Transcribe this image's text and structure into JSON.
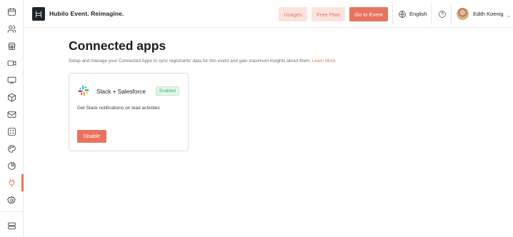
{
  "header": {
    "brand": "Hubilo Event. Reimagine.",
    "usages_label": "Usages",
    "free_plan_label": "Free Plan",
    "go_to_event_label": "Go to Event",
    "language": "English",
    "user_name": "Edith Koenig"
  },
  "sidebar": {
    "items": [
      {
        "icon": "calendar-icon"
      },
      {
        "icon": "users-icon"
      },
      {
        "icon": "store-icon"
      },
      {
        "icon": "video-icon"
      },
      {
        "icon": "screen-share-icon"
      },
      {
        "icon": "box-icon"
      },
      {
        "icon": "mail-icon"
      },
      {
        "icon": "dice-icon"
      },
      {
        "icon": "palette-icon"
      },
      {
        "icon": "pie-chart-icon"
      },
      {
        "icon": "plug-icon",
        "active": true
      },
      {
        "icon": "settings-icon"
      },
      {
        "icon": "server-icon"
      }
    ]
  },
  "main": {
    "title": "Connected apps",
    "subtitle": "Setup and manage your Connected Apps to sync registrants' data for this event and gain maximum insights about them.",
    "learn_more": "Learn More",
    "apps": [
      {
        "icon": "slack-icon",
        "name": "Slack + Salesforce",
        "status": "Enabled",
        "description": "Get Slack notifications on lead activities",
        "action_label": "Disable"
      }
    ]
  },
  "colors": {
    "accent": "#e8735f",
    "accent_light": "#fde3de",
    "enabled_green": "#3fae5e",
    "enabled_bg": "#e3f6e8"
  }
}
